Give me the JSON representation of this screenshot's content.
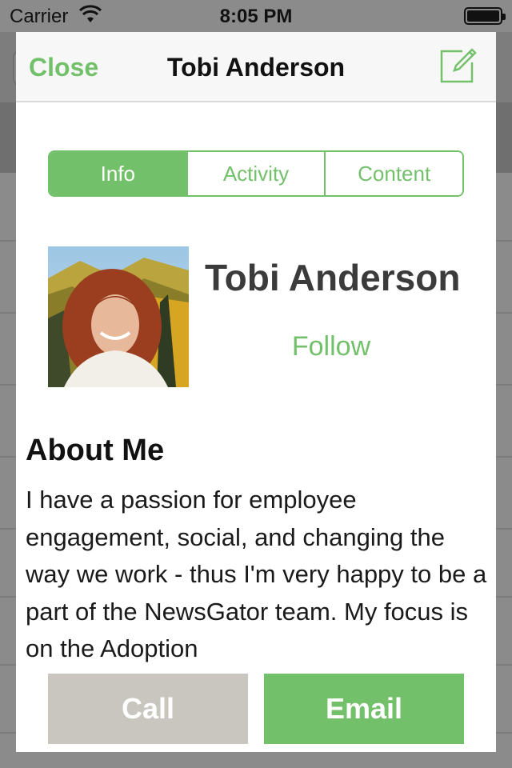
{
  "status_bar": {
    "carrier": "Carrier",
    "time": "8:05 PM",
    "wifi_icon": "wifi-icon",
    "battery_icon": "battery-full-icon"
  },
  "header": {
    "close_label": "Close",
    "title": "Tobi Anderson",
    "compose_icon": "compose-icon"
  },
  "tabs": [
    {
      "label": "Info",
      "active": true
    },
    {
      "label": "Activity",
      "active": false
    },
    {
      "label": "Content",
      "active": false
    }
  ],
  "profile": {
    "name": "Tobi Anderson",
    "follow_label": "Follow"
  },
  "about": {
    "heading": "About Me",
    "body": "I have a passion for employee engagement, social, and changing the way we work - thus I'm very happy to be a part of the NewsGator team. My focus is on the Adoption"
  },
  "actions": {
    "call_label": "Call",
    "email_label": "Email"
  },
  "colors": {
    "accent": "#72c16a",
    "call_button": "#c9c6c0"
  }
}
